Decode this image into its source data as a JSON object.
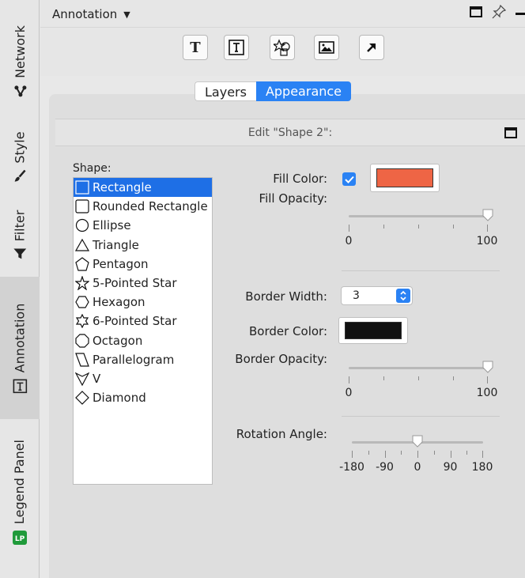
{
  "side_tabs": [
    {
      "label": "Network",
      "icon": "network-icon"
    },
    {
      "label": "Style",
      "icon": "brush-icon"
    },
    {
      "label": "Filter",
      "icon": "filter-icon"
    },
    {
      "label": "Annotation",
      "icon": "text-box-icon"
    },
    {
      "label": "Legend Panel",
      "icon": "legend-panel-icon",
      "icon_text": "LP"
    }
  ],
  "header": {
    "title": "Annotation",
    "dropdown_icon": "caret-down-icon"
  },
  "toolbar": {
    "buttons": [
      {
        "name": "add-text-button",
        "glyph": "T"
      },
      {
        "name": "add-bounded-text-button",
        "glyph": "T"
      },
      {
        "name": "add-shape-button",
        "glyph": "shape"
      },
      {
        "name": "add-image-button",
        "glyph": "image"
      },
      {
        "name": "add-arrow-button",
        "glyph": "arrow"
      }
    ]
  },
  "tabs": {
    "layers": "Layers",
    "appearance": "Appearance",
    "selected": "Appearance"
  },
  "edit": {
    "title": "Edit \"Shape 2\":"
  },
  "shape": {
    "label": "Shape:",
    "selected": "Rectangle",
    "items": [
      "Rectangle",
      "Rounded Rectangle",
      "Ellipse",
      "Triangle",
      "Pentagon",
      "5-Pointed Star",
      "Hexagon",
      "6-Pointed Star",
      "Octagon",
      "Parallelogram",
      "V",
      "Diamond"
    ]
  },
  "fill": {
    "color_label": "Fill Color:",
    "enabled": true,
    "color": "#ee6545",
    "opacity_label": "Fill Opacity:",
    "opacity": 100,
    "min_label": "0",
    "max_label": "100"
  },
  "border": {
    "width_label": "Border Width:",
    "width": "3",
    "color_label": "Border Color:",
    "color": "#111111",
    "opacity_label": "Border Opacity:",
    "opacity": 100,
    "min_label": "0",
    "max_label": "100"
  },
  "rotation": {
    "label": "Rotation Angle:",
    "value": 0,
    "tick_labels": [
      "-180",
      "-90",
      "0",
      "90",
      "180"
    ]
  },
  "colors": {
    "accent": "#2a82f4",
    "selection": "#1e6fe6"
  }
}
